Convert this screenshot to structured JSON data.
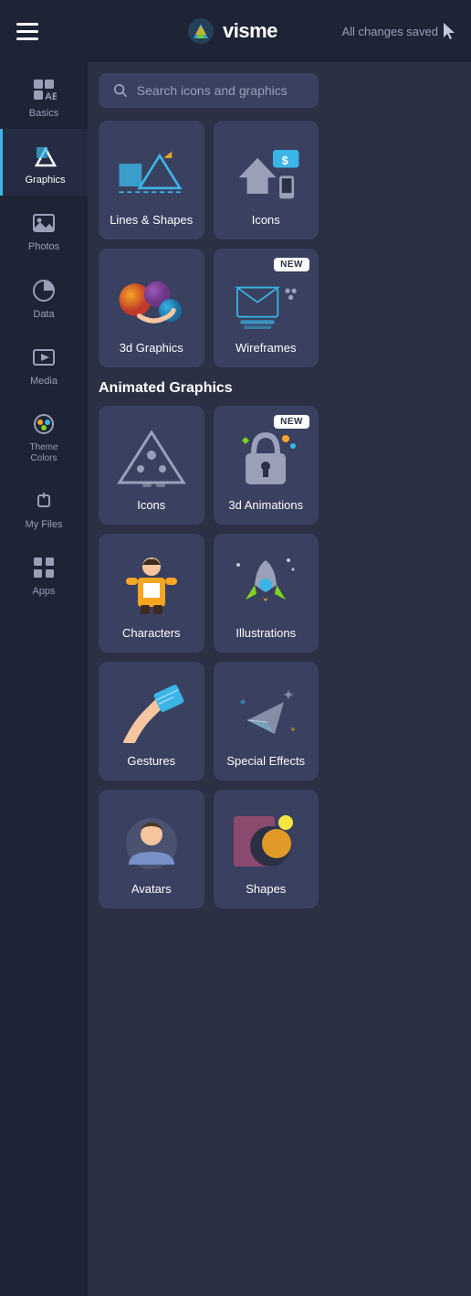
{
  "header": {
    "brand": "visme",
    "saved_status": "All changes saved"
  },
  "sidebar": {
    "hamburger_label": "menu",
    "items": [
      {
        "id": "basics",
        "label": "Basics",
        "icon": "basics-icon",
        "active": false
      },
      {
        "id": "graphics",
        "label": "Graphics",
        "icon": "graphics-icon",
        "active": true
      },
      {
        "id": "photos",
        "label": "Photos",
        "icon": "photos-icon",
        "active": false
      },
      {
        "id": "data",
        "label": "Data",
        "icon": "data-icon",
        "active": false
      },
      {
        "id": "media",
        "label": "Media",
        "icon": "media-icon",
        "active": false
      },
      {
        "id": "theme-colors",
        "label": "Theme Colors",
        "icon": "theme-colors-icon",
        "active": false
      },
      {
        "id": "my-files",
        "label": "My Files",
        "icon": "my-files-icon",
        "active": false
      },
      {
        "id": "apps",
        "label": "Apps",
        "icon": "apps-icon",
        "active": false
      }
    ]
  },
  "main": {
    "search_placeholder": "Search icons and graphics",
    "static_grid": {
      "title": "",
      "items": [
        {
          "id": "lines-shapes",
          "label": "Lines & Shapes",
          "badge": ""
        },
        {
          "id": "icons",
          "label": "Icons",
          "badge": ""
        },
        {
          "id": "3d-graphics",
          "label": "3d Graphics",
          "badge": ""
        },
        {
          "id": "wireframes",
          "label": "Wireframes",
          "badge": "NEW"
        }
      ]
    },
    "animated_section": {
      "title": "Animated Graphics",
      "items": [
        {
          "id": "anim-icons",
          "label": "Icons",
          "badge": ""
        },
        {
          "id": "3d-animations",
          "label": "3d Animations",
          "badge": "NEW"
        },
        {
          "id": "characters",
          "label": "Characters",
          "badge": ""
        },
        {
          "id": "illustrations",
          "label": "Illustrations",
          "badge": ""
        },
        {
          "id": "gestures",
          "label": "Gestures",
          "badge": ""
        },
        {
          "id": "special-effects",
          "label": "Special Effects",
          "badge": ""
        },
        {
          "id": "avatars",
          "label": "Avatars",
          "badge": ""
        },
        {
          "id": "shapes",
          "label": "Shapes",
          "badge": ""
        }
      ]
    }
  }
}
